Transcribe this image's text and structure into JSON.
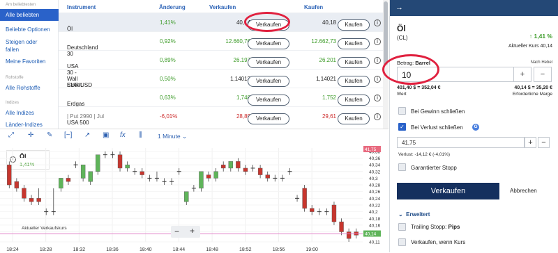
{
  "sidebar": {
    "section1": "Am beliebtesten",
    "items": [
      "Alle beliebten",
      "Beliebte Optionen",
      "Steigen oder fallen",
      "Meine Favoriten"
    ],
    "section2": "Rohstoffe",
    "item_rohstoffe": "Alle Rohstoffe",
    "section3": "Indizes",
    "item_indizes": "Alle Indizes",
    "item_laender": "Länder-Indizes"
  },
  "table": {
    "headers": {
      "instrument": "Instrument",
      "change": "Änderung",
      "sell": "Verkaufen",
      "buy": "Kaufen"
    },
    "sell_label": "Verkaufen",
    "buy_label": "Kaufen",
    "rows": [
      {
        "name": "Öl",
        "change": "1,41%",
        "sell": "40,14",
        "buy": "40,18",
        "dir": "up"
      },
      {
        "name": "Deutschland 30",
        "change": "0,92%",
        "sell": "12.660,76",
        "buy": "12.662,73",
        "dir": "up"
      },
      {
        "name": "USA 30 - Wall Street",
        "change": "0,89%",
        "sell": "26.197",
        "buy": "26.201",
        "dir": "up"
      },
      {
        "name": "EUR/USD",
        "change": "0,50%",
        "sell": "1,14013",
        "buy": "1,14021",
        "dir": "flat"
      },
      {
        "name": "Erdgas",
        "change": "0,63%",
        "sell": "1,748",
        "buy": "1,752",
        "dir": "up"
      },
      {
        "name": "USA 500",
        "name_sub": " | Put 2990 | Jul",
        "change": "-6,01%",
        "sell": "28,89",
        "buy": "29,61",
        "dir": "down"
      }
    ]
  },
  "chart": {
    "interval": "1 Minute",
    "instrument_label": "Öl",
    "instrument_change": "1,41%",
    "price_line_label": "Aktueller Verkaufskurs",
    "zoom_minus": "−",
    "zoom_plus": "+",
    "price_flag_top": "41,75",
    "price_flag_current": "40,14",
    "chart_data": {
      "type": "candlestick",
      "x": [
        "18:24",
        "18:28",
        "18:32",
        "18:36",
        "18:40",
        "18:44",
        "18:48",
        "18:52",
        "18:56",
        "19:00"
      ],
      "y_ticks": [
        "40,38",
        "40,36",
        "40,34",
        "40,32",
        "40,3",
        "40,28",
        "40,26",
        "40,24",
        "40,22",
        "40,2",
        "40,18",
        "40,16",
        "40,14",
        "40,11"
      ],
      "ylim": [
        40.11,
        40.39
      ],
      "candles": [
        {
          "o": 40.34,
          "h": 40.35,
          "c": 40.28,
          "l": 40.27
        },
        {
          "o": 40.29,
          "h": 40.3,
          "c": 40.27,
          "l": 40.26
        },
        {
          "o": 40.27,
          "h": 40.28,
          "c": 40.24,
          "l": 40.23
        },
        {
          "o": 40.24,
          "h": 40.25,
          "c": 40.23,
          "l": 40.22
        },
        {
          "o": 40.24,
          "h": 40.27,
          "c": 40.23,
          "l": 40.22
        },
        {
          "o": 40.2,
          "h": 40.21,
          "c": 40.2,
          "l": 40.19
        },
        {
          "o": 40.2,
          "h": 40.27,
          "c": 40.2,
          "l": 40.19
        },
        {
          "o": 40.27,
          "h": 40.28,
          "c": 40.3,
          "l": 40.26
        },
        {
          "o": 40.3,
          "h": 40.31,
          "c": 40.29,
          "l": 40.28
        },
        {
          "o": 40.34,
          "h": 40.35,
          "c": 40.34,
          "l": 40.33
        },
        {
          "o": 40.3,
          "h": 40.32,
          "c": 40.34,
          "l": 40.29
        },
        {
          "o": 40.29,
          "h": 40.31,
          "c": 40.32,
          "l": 40.28
        },
        {
          "o": 40.32,
          "h": 40.33,
          "c": 40.37,
          "l": 40.31
        },
        {
          "o": 40.37,
          "h": 40.38,
          "c": 40.37,
          "l": 40.36
        },
        {
          "o": 40.37,
          "h": 40.38,
          "c": 40.37,
          "l": 40.36
        },
        {
          "o": 40.37,
          "h": 40.38,
          "c": 40.33,
          "l": 40.32
        },
        {
          "o": 40.33,
          "h": 40.35,
          "c": 40.34,
          "l": 40.32
        },
        {
          "o": 40.32,
          "h": 40.33,
          "c": 40.32,
          "l": 40.31
        },
        {
          "o": 40.32,
          "h": 40.33,
          "c": 40.31,
          "l": 40.3
        },
        {
          "o": 40.3,
          "h": 40.31,
          "c": 40.3,
          "l": 40.29
        },
        {
          "o": 40.3,
          "h": 40.32,
          "c": 40.3,
          "l": 40.29
        },
        {
          "o": 40.29,
          "h": 40.3,
          "c": 40.29,
          "l": 40.28
        },
        {
          "o": 40.29,
          "h": 40.3,
          "c": 40.29,
          "l": 40.28
        },
        {
          "o": 40.32,
          "h": 40.33,
          "c": 40.32,
          "l": 40.31
        },
        {
          "o": 40.23,
          "h": 40.24,
          "c": 40.26,
          "l": 40.22
        },
        {
          "o": 40.27,
          "h": 40.28,
          "c": 40.27,
          "l": 40.26
        },
        {
          "o": 40.27,
          "h": 40.29,
          "c": 40.32,
          "l": 40.26
        },
        {
          "o": 40.31,
          "h": 40.32,
          "c": 40.3,
          "l": 40.29
        },
        {
          "o": 40.3,
          "h": 40.33,
          "c": 40.32,
          "l": 40.29
        },
        {
          "o": 40.34,
          "h": 40.35,
          "c": 40.33,
          "l": 40.32
        },
        {
          "o": 40.33,
          "h": 40.35,
          "c": 40.35,
          "l": 40.32
        },
        {
          "o": 40.35,
          "h": 40.36,
          "c": 40.33,
          "l": 40.32
        },
        {
          "o": 40.33,
          "h": 40.34,
          "c": 40.32,
          "l": 40.31
        },
        {
          "o": 40.33,
          "h": 40.34,
          "c": 40.33,
          "l": 40.32
        },
        {
          "o": 40.33,
          "h": 40.34,
          "c": 40.31,
          "l": 40.3
        },
        {
          "o": 40.31,
          "h": 40.32,
          "c": 40.3,
          "l": 40.29
        },
        {
          "o": 40.3,
          "h": 40.31,
          "c": 40.3,
          "l": 40.29
        },
        {
          "o": 40.3,
          "h": 40.31,
          "c": 40.3,
          "l": 40.29
        },
        {
          "o": 40.32,
          "h": 40.33,
          "c": 40.32,
          "l": 40.31
        },
        {
          "o": 40.24,
          "h": 40.25,
          "c": 40.24,
          "l": 40.23
        },
        {
          "o": 40.27,
          "h": 40.28,
          "c": 40.21,
          "l": 40.2
        },
        {
          "o": 40.21,
          "h": 40.22,
          "c": 40.2,
          "l": 40.19
        },
        {
          "o": 40.2,
          "h": 40.21,
          "c": 40.2,
          "l": 40.19
        },
        {
          "o": 40.2,
          "h": 40.21,
          "c": 40.2,
          "l": 40.19
        },
        {
          "o": 40.22,
          "h": 40.23,
          "c": 40.17,
          "l": 40.16
        },
        {
          "o": 40.17,
          "h": 40.18,
          "c": 40.14,
          "l": 40.13
        },
        {
          "o": 40.14,
          "h": 40.15,
          "c": 40.12,
          "l": 40.11
        },
        {
          "o": 40.14,
          "h": 40.15,
          "c": 40.13,
          "l": 40.12
        }
      ]
    }
  },
  "panel": {
    "name": "Öl",
    "code": "(CL)",
    "change": "1,41 %",
    "current_label": "Aktueller Kurs",
    "current_value": "40,14",
    "amount_label": "Betrag:",
    "amount_unit": "Barrel",
    "leverage_label": "Nach Hebel",
    "amount_value": "10",
    "plus": "+",
    "minus": "−",
    "value_text": "401,40 $ = 352,04 €",
    "value_label": "Wert",
    "margin_text": "40,14 $ = 35,20 €",
    "margin_label": "Erforderliche Marge",
    "take_profit": "Bei Gewinn schließen",
    "stop_loss": "Bei Verlust schließen",
    "stop_value": "41,75",
    "loss_text": "Verlust: -14,12 € (-4,01%)",
    "guaranteed": "Garantierter Stopp",
    "sell_btn": "Verkaufen",
    "cancel_btn": "Abbrechen",
    "advanced": "Erweitert",
    "trailing": "Trailing Stopp:",
    "trailing_unit": "Pips",
    "sell_when": "Verkaufen, wenn Kurs"
  },
  "colors": {
    "accent": "#2a62c9",
    "navy": "#15305e",
    "up": "#3c9b28",
    "down": "#cc2a2a",
    "highlight": "#e0213f"
  }
}
